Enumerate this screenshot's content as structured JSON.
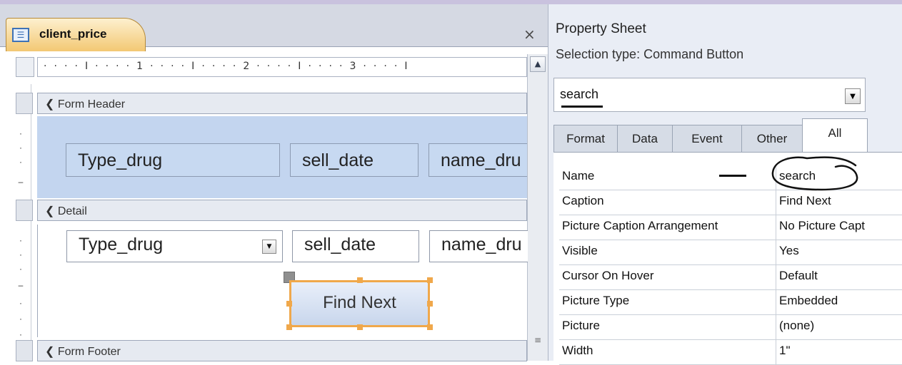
{
  "document": {
    "tab_title": "client_price",
    "close_glyph": "×"
  },
  "ruler": {
    "marks": "· · · · I · · · · 1 · · · · I · · · · 2 · · · · I · · · · 3 · · · · I"
  },
  "sections": {
    "form_header": "Form Header",
    "detail": "Detail",
    "form_footer": "Form Footer"
  },
  "header_fields": [
    "Type_drug",
    "sell_date",
    "name_dru"
  ],
  "detail_fields": [
    "Type_drug",
    "sell_date",
    "name_dru"
  ],
  "button": {
    "caption": "Find Next"
  },
  "property_sheet": {
    "title": "Property Sheet",
    "selection_type": "Selection type:  Command Button",
    "object": "search",
    "tabs": [
      "Format",
      "Data",
      "Event",
      "Other",
      "All"
    ],
    "active_tab": "All",
    "properties": [
      {
        "name": "Name",
        "value": "search"
      },
      {
        "name": "Caption",
        "value": "Find Next"
      },
      {
        "name": "Picture Caption Arrangement",
        "value": "No Picture Capt"
      },
      {
        "name": "Visible",
        "value": "Yes"
      },
      {
        "name": "Cursor On Hover",
        "value": "Default"
      },
      {
        "name": "Picture Type",
        "value": "Embedded"
      },
      {
        "name": "Picture",
        "value": "(none)"
      },
      {
        "name": "Width",
        "value": "1\""
      }
    ]
  },
  "icons": {
    "form": "form-icon",
    "section": "section-collapse-icon",
    "dropdown": "dropdown-arrow-icon",
    "scroll_up": "scroll-up-arrow-icon"
  },
  "colors": {
    "selection": "#f0a84b",
    "header_bg": "#c3d5ef",
    "tab_active": "#f3c873"
  }
}
